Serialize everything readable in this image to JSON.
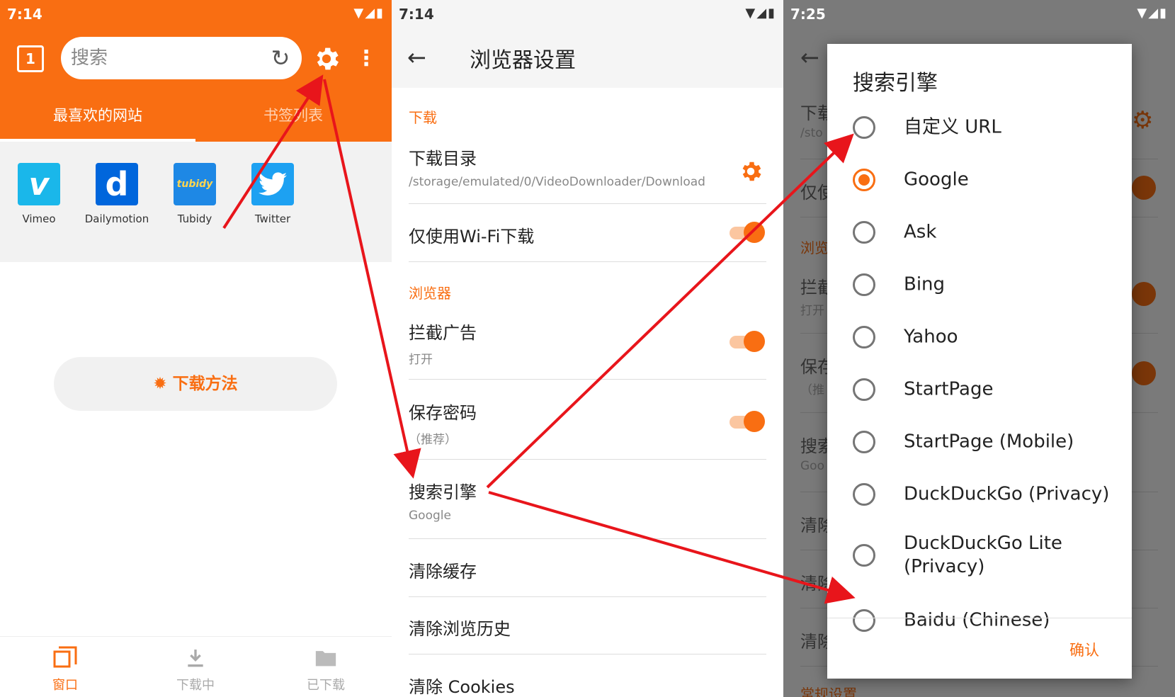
{
  "screen1": {
    "status": {
      "time": "7:14"
    },
    "tab_count": "1",
    "search": {
      "placeholder": "搜索"
    },
    "tabs": [
      "最喜欢的网站",
      "书签列表"
    ],
    "favorites": [
      {
        "label": "Vimeo",
        "icon": "vimeo-logo",
        "glyph": "v",
        "color": "#1ab7ea"
      },
      {
        "label": "Dailymotion",
        "icon": "dailymotion-logo",
        "glyph": "d",
        "color": "#0066dc"
      },
      {
        "label": "Tubidy",
        "icon": "tubidy-logo",
        "glyph": "tubidy",
        "color": "#1e88e5"
      },
      {
        "label": "Twitter",
        "icon": "twitter-bird-logo",
        "color": "#1da1f2"
      }
    ],
    "howto_label": "下载方法",
    "bottom_nav": [
      {
        "label": "窗口",
        "icon": "windows-icon"
      },
      {
        "label": "下载中",
        "icon": "download-icon"
      },
      {
        "label": "已下载",
        "icon": "folder-icon"
      }
    ]
  },
  "screen2": {
    "status": {
      "time": "7:14"
    },
    "title": "浏览器设置",
    "sections": {
      "download": "下载",
      "browser": "浏览器"
    },
    "prefs": {
      "download_dir": {
        "title": "下载目录",
        "summary": "/storage/emulated/0/VideoDownloader/Download"
      },
      "wifi_only": {
        "title": "仅使用Wi-Fi下载",
        "on": true
      },
      "block_ads": {
        "title": "拦截广告",
        "summary": "打开",
        "on": true
      },
      "save_password": {
        "title": "保存密码",
        "summary": "（推荐）",
        "on": true
      },
      "search_engine": {
        "title": "搜索引擎",
        "summary": "Google"
      },
      "clear_cache": {
        "title": "清除缓存"
      },
      "clear_history": {
        "title": "清除浏览历史"
      },
      "clear_cookies": {
        "title": "清除 Cookies"
      }
    }
  },
  "screen3": {
    "status": {
      "time": "7:25"
    },
    "background": {
      "t1": "下载",
      "t1s": "/sto",
      "t2": "仅使",
      "t3": "浏览",
      "t4": "拦截",
      "t4s": "打开",
      "t5": "保存",
      "t5s": "（推",
      "t6": "搜索",
      "t6s": "Goo",
      "t7": "清除",
      "t8": "清除",
      "t9": "清除",
      "t10": "常规设置"
    },
    "dialog": {
      "title": "搜索引擎",
      "options": [
        "自定义 URL",
        "Google",
        "Ask",
        "Bing",
        "Yahoo",
        "StartPage",
        "StartPage (Mobile)",
        "DuckDuckGo (Privacy)",
        "DuckDuckGo Lite\n(Privacy)",
        "Baidu (Chinese)"
      ],
      "selected_index": 1,
      "confirm_label": "确认"
    }
  },
  "colors": {
    "accent": "#f96e12",
    "annotation_arrow": "#e8151b"
  }
}
